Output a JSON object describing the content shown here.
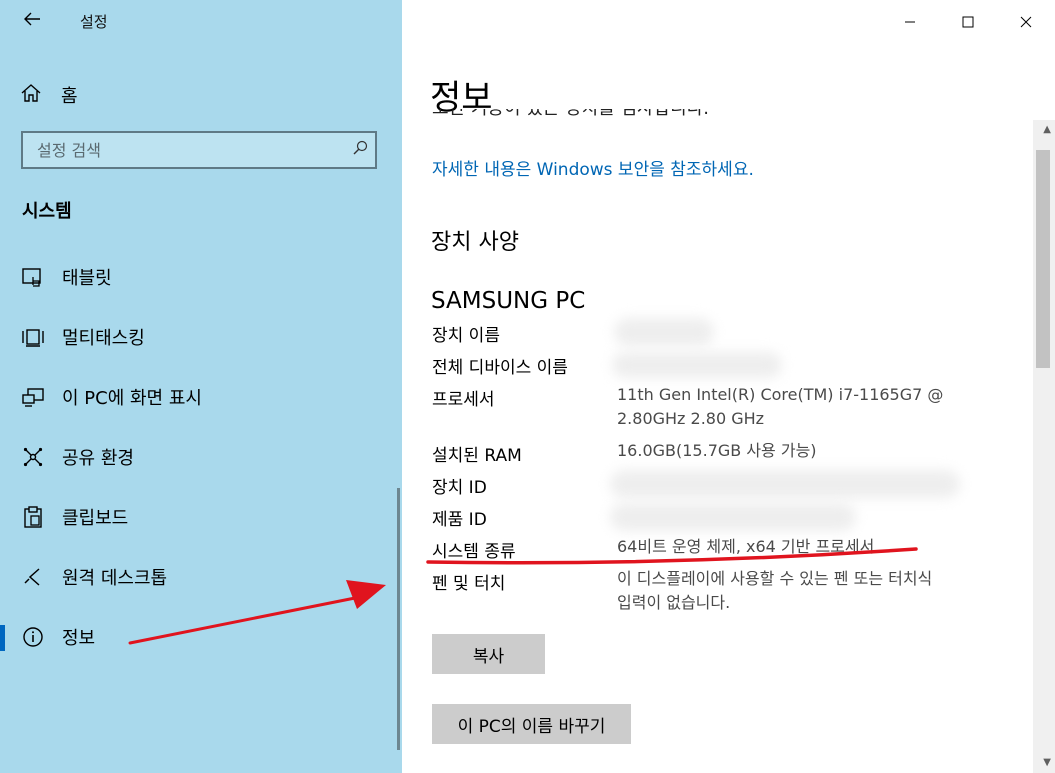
{
  "app": {
    "title": "설정"
  },
  "sidebar": {
    "home_label": "홈",
    "search_placeholder": "설정 검색",
    "section_title": "시스템",
    "items": [
      {
        "label": "태블릿",
        "icon": "tablet-icon"
      },
      {
        "label": "멀티태스킹",
        "icon": "multitasking-icon"
      },
      {
        "label": "이 PC에 화면 표시",
        "icon": "project-to-pc-icon"
      },
      {
        "label": "공유 환경",
        "icon": "shared-experiences-icon"
      },
      {
        "label": "클립보드",
        "icon": "clipboard-icon"
      },
      {
        "label": "원격 데스크톱",
        "icon": "remote-desktop-icon"
      },
      {
        "label": "정보",
        "icon": "info-icon",
        "selected": true
      }
    ]
  },
  "content": {
    "page_title": "정보",
    "cut_text": "보안 기능이 있는 장치를 검사합니다.",
    "security_link": "자세한 내용은 Windows 보안을 참조하세요.",
    "device_specs_title": "장치 사양",
    "device_name": "SAMSUNG PC",
    "specs": [
      {
        "label": "장치 이름",
        "value": ""
      },
      {
        "label": "전체 디바이스 이름",
        "value": ""
      },
      {
        "label": "프로세서",
        "value": "11th Gen Intel(R) Core(TM) i7-1165G7 @",
        "value2": "2.80GHz   2.80 GHz"
      },
      {
        "label": "설치된 RAM",
        "value": "16.0GB(15.7GB 사용 가능)"
      },
      {
        "label": "장치 ID",
        "value": ""
      },
      {
        "label": "제품 ID",
        "value": ""
      },
      {
        "label": "시스템 종류",
        "value": "64비트 운영 체제, x64 기반 프로세서"
      },
      {
        "label": "펜 및 터치",
        "value": "이 디스플레이에 사용할 수 있는 펜 또는 터치식",
        "value2": "입력이 없습니다."
      }
    ],
    "copy_button": "복사",
    "rename_button": "이 PC의 이름 바꾸기"
  },
  "colors": {
    "sidebar_bg": "#a9d9ec",
    "accent": "#0066b4",
    "annotation_red": "#e0141e"
  }
}
